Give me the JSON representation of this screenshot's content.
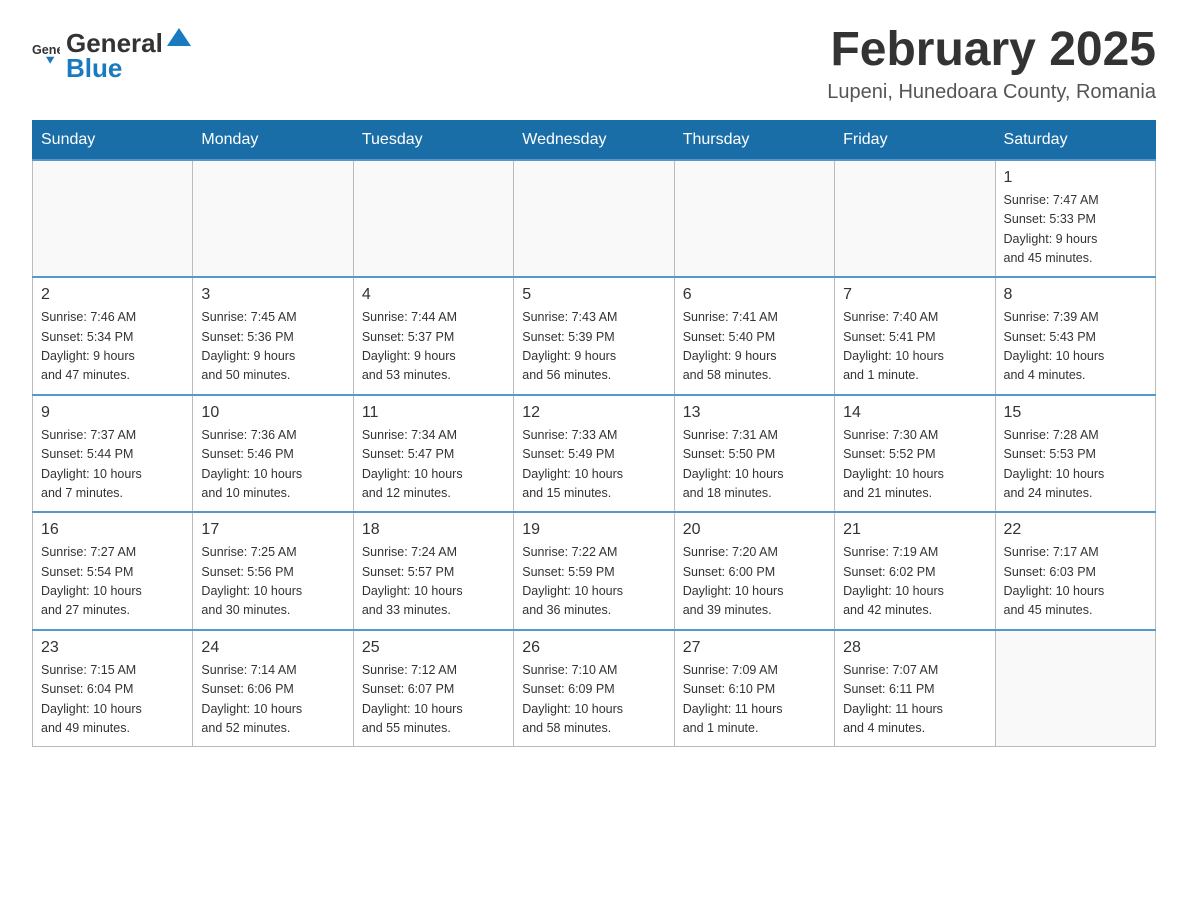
{
  "logo": {
    "text_general": "General",
    "text_blue": "Blue"
  },
  "title": "February 2025",
  "subtitle": "Lupeni, Hunedoara County, Romania",
  "days_of_week": [
    "Sunday",
    "Monday",
    "Tuesday",
    "Wednesday",
    "Thursday",
    "Friday",
    "Saturday"
  ],
  "weeks": [
    [
      {
        "day": "",
        "info": ""
      },
      {
        "day": "",
        "info": ""
      },
      {
        "day": "",
        "info": ""
      },
      {
        "day": "",
        "info": ""
      },
      {
        "day": "",
        "info": ""
      },
      {
        "day": "",
        "info": ""
      },
      {
        "day": "1",
        "info": "Sunrise: 7:47 AM\nSunset: 5:33 PM\nDaylight: 9 hours\nand 45 minutes."
      }
    ],
    [
      {
        "day": "2",
        "info": "Sunrise: 7:46 AM\nSunset: 5:34 PM\nDaylight: 9 hours\nand 47 minutes."
      },
      {
        "day": "3",
        "info": "Sunrise: 7:45 AM\nSunset: 5:36 PM\nDaylight: 9 hours\nand 50 minutes."
      },
      {
        "day": "4",
        "info": "Sunrise: 7:44 AM\nSunset: 5:37 PM\nDaylight: 9 hours\nand 53 minutes."
      },
      {
        "day": "5",
        "info": "Sunrise: 7:43 AM\nSunset: 5:39 PM\nDaylight: 9 hours\nand 56 minutes."
      },
      {
        "day": "6",
        "info": "Sunrise: 7:41 AM\nSunset: 5:40 PM\nDaylight: 9 hours\nand 58 minutes."
      },
      {
        "day": "7",
        "info": "Sunrise: 7:40 AM\nSunset: 5:41 PM\nDaylight: 10 hours\nand 1 minute."
      },
      {
        "day": "8",
        "info": "Sunrise: 7:39 AM\nSunset: 5:43 PM\nDaylight: 10 hours\nand 4 minutes."
      }
    ],
    [
      {
        "day": "9",
        "info": "Sunrise: 7:37 AM\nSunset: 5:44 PM\nDaylight: 10 hours\nand 7 minutes."
      },
      {
        "day": "10",
        "info": "Sunrise: 7:36 AM\nSunset: 5:46 PM\nDaylight: 10 hours\nand 10 minutes."
      },
      {
        "day": "11",
        "info": "Sunrise: 7:34 AM\nSunset: 5:47 PM\nDaylight: 10 hours\nand 12 minutes."
      },
      {
        "day": "12",
        "info": "Sunrise: 7:33 AM\nSunset: 5:49 PM\nDaylight: 10 hours\nand 15 minutes."
      },
      {
        "day": "13",
        "info": "Sunrise: 7:31 AM\nSunset: 5:50 PM\nDaylight: 10 hours\nand 18 minutes."
      },
      {
        "day": "14",
        "info": "Sunrise: 7:30 AM\nSunset: 5:52 PM\nDaylight: 10 hours\nand 21 minutes."
      },
      {
        "day": "15",
        "info": "Sunrise: 7:28 AM\nSunset: 5:53 PM\nDaylight: 10 hours\nand 24 minutes."
      }
    ],
    [
      {
        "day": "16",
        "info": "Sunrise: 7:27 AM\nSunset: 5:54 PM\nDaylight: 10 hours\nand 27 minutes."
      },
      {
        "day": "17",
        "info": "Sunrise: 7:25 AM\nSunset: 5:56 PM\nDaylight: 10 hours\nand 30 minutes."
      },
      {
        "day": "18",
        "info": "Sunrise: 7:24 AM\nSunset: 5:57 PM\nDaylight: 10 hours\nand 33 minutes."
      },
      {
        "day": "19",
        "info": "Sunrise: 7:22 AM\nSunset: 5:59 PM\nDaylight: 10 hours\nand 36 minutes."
      },
      {
        "day": "20",
        "info": "Sunrise: 7:20 AM\nSunset: 6:00 PM\nDaylight: 10 hours\nand 39 minutes."
      },
      {
        "day": "21",
        "info": "Sunrise: 7:19 AM\nSunset: 6:02 PM\nDaylight: 10 hours\nand 42 minutes."
      },
      {
        "day": "22",
        "info": "Sunrise: 7:17 AM\nSunset: 6:03 PM\nDaylight: 10 hours\nand 45 minutes."
      }
    ],
    [
      {
        "day": "23",
        "info": "Sunrise: 7:15 AM\nSunset: 6:04 PM\nDaylight: 10 hours\nand 49 minutes."
      },
      {
        "day": "24",
        "info": "Sunrise: 7:14 AM\nSunset: 6:06 PM\nDaylight: 10 hours\nand 52 minutes."
      },
      {
        "day": "25",
        "info": "Sunrise: 7:12 AM\nSunset: 6:07 PM\nDaylight: 10 hours\nand 55 minutes."
      },
      {
        "day": "26",
        "info": "Sunrise: 7:10 AM\nSunset: 6:09 PM\nDaylight: 10 hours\nand 58 minutes."
      },
      {
        "day": "27",
        "info": "Sunrise: 7:09 AM\nSunset: 6:10 PM\nDaylight: 11 hours\nand 1 minute."
      },
      {
        "day": "28",
        "info": "Sunrise: 7:07 AM\nSunset: 6:11 PM\nDaylight: 11 hours\nand 4 minutes."
      },
      {
        "day": "",
        "info": ""
      }
    ]
  ]
}
